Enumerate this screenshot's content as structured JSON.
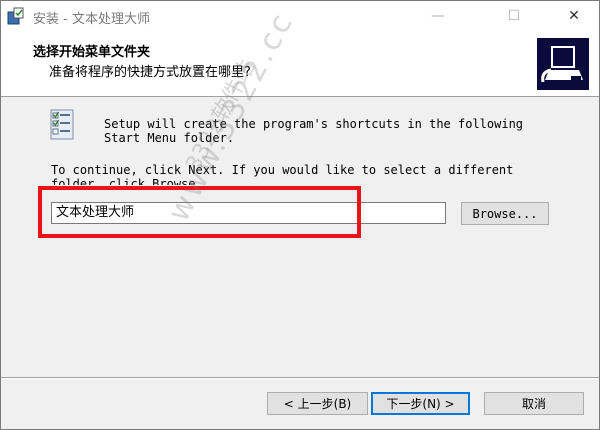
{
  "window": {
    "title": "安装 - 文本处理大师",
    "controls": {
      "minimize": "—",
      "maximize": "☐",
      "close": "✕"
    }
  },
  "header": {
    "title": "选择开始菜单文件夹",
    "subtitle": "准备将程序的快捷方式放置在哪里?"
  },
  "body": {
    "intro_line1": "Setup will create the program's shortcuts in the following",
    "intro_line2": "Start Menu folder.",
    "instruction_line1": "To continue, click Next. If you would like to select a different",
    "instruction_line2": "folder, click Browse."
  },
  "folder_input": {
    "value": "文本处理大师"
  },
  "buttons": {
    "browse": "Browse...",
    "back": "< 上一步(B)",
    "next": "下一步(N) >",
    "cancel": "取消"
  },
  "watermark": {
    "text": "www.3322.cc",
    "text2": "3322软件站"
  },
  "colors": {
    "highlight": "#e8141a",
    "default_button_border": "#0078d7"
  },
  "icons": {
    "app": "installer-icon",
    "logo": "setup-computer-logo",
    "folder": "start-menu-checklist-icon"
  }
}
